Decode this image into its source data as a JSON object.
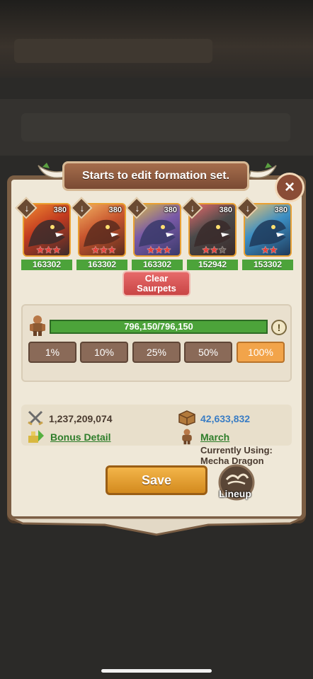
{
  "title": "Starts to edit formation set.",
  "dinos": [
    {
      "level": "380",
      "power": "163302",
      "stars": 3,
      "max_stars": 3,
      "colors": [
        "#3a2b2b",
        "#c23a20",
        "#f08a30"
      ]
    },
    {
      "level": "380",
      "power": "163302",
      "stars": 3,
      "max_stars": 3,
      "colors": [
        "#5a2c1e",
        "#c8552e",
        "#f2b060"
      ]
    },
    {
      "level": "380",
      "power": "163302",
      "stars": 3,
      "max_stars": 3,
      "colors": [
        "#3a3a6a",
        "#7a5aa8",
        "#d9b84a"
      ]
    },
    {
      "level": "380",
      "power": "152942",
      "stars": 2,
      "max_stars": 3,
      "colors": [
        "#3a2a2a",
        "#4a4a4a",
        "#e86a6a"
      ]
    },
    {
      "level": "380",
      "power": "153302",
      "stars": 2,
      "max_stars": 2,
      "colors": [
        "#1f3a5a",
        "#3c8fc4",
        "#e8c070"
      ]
    }
  ],
  "clear_button": {
    "line1": "Clear",
    "line2": "Saurpets"
  },
  "troops": {
    "value": "796,150/796,150",
    "warning_icon": "!"
  },
  "percent_buttons": [
    "1%",
    "10%",
    "25%",
    "50%",
    "100%"
  ],
  "selected_percent": "100%",
  "stats": {
    "power": "1,237,209,074",
    "bonus_link": "Bonus Detail",
    "supply": "42,633,832",
    "march_link": "March",
    "currently_using_line1": "Currently Using:",
    "currently_using_line2": "Mecha Dragon"
  },
  "save_label": "Save",
  "lineup_label": "Lineup",
  "close_icon": "×"
}
